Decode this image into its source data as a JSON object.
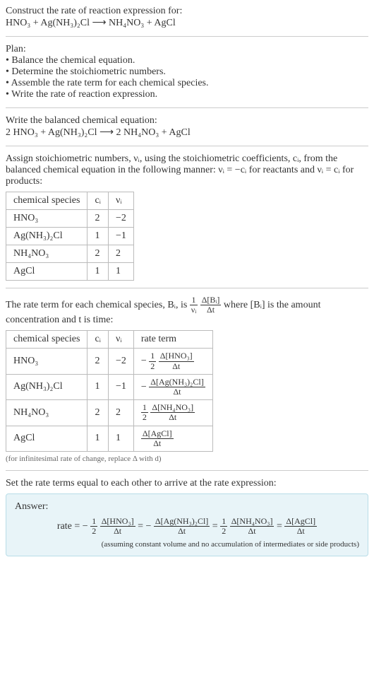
{
  "header": {
    "title": "Construct the rate of reaction expression for:",
    "equation": "HNO₃ + Ag(NH₃)₂Cl  ⟶  NH₄NO₃ + AgCl"
  },
  "plan": {
    "title": "Plan:",
    "items": [
      "• Balance the chemical equation.",
      "• Determine the stoichiometric numbers.",
      "• Assemble the rate term for each chemical species.",
      "• Write the rate of reaction expression."
    ]
  },
  "balanced": {
    "title": "Write the balanced chemical equation:",
    "equation": "2 HNO₃ + Ag(NH₃)₂Cl  ⟶  2 NH₄NO₃ + AgCl"
  },
  "stoich": {
    "intro": "Assign stoichiometric numbers, νᵢ, using the stoichiometric coefficients, cᵢ, from the balanced chemical equation in the following manner: νᵢ = −cᵢ for reactants and νᵢ = cᵢ for products:",
    "headers": [
      "chemical species",
      "cᵢ",
      "νᵢ"
    ],
    "rows": [
      {
        "species": "HNO₃",
        "c": "2",
        "v": "−2"
      },
      {
        "species": "Ag(NH₃)₂Cl",
        "c": "1",
        "v": "−1"
      },
      {
        "species": "NH₄NO₃",
        "c": "2",
        "v": "2"
      },
      {
        "species": "AgCl",
        "c": "1",
        "v": "1"
      }
    ]
  },
  "rateterm": {
    "intro_a": "The rate term for each chemical species, Bᵢ, is ",
    "intro_b": " where [Bᵢ] is the amount concentration and t is time:",
    "headers": [
      "chemical species",
      "cᵢ",
      "νᵢ",
      "rate term"
    ],
    "rows": [
      {
        "species": "HNO₃",
        "c": "2",
        "v": "−2",
        "sign": "−",
        "coef_num": "1",
        "coef_den": "2",
        "delta": "Δ[HNO₃]"
      },
      {
        "species": "Ag(NH₃)₂Cl",
        "c": "1",
        "v": "−1",
        "sign": "−",
        "coef_num": "",
        "coef_den": "",
        "delta": "Δ[Ag(NH₃)₂Cl]"
      },
      {
        "species": "NH₄NO₃",
        "c": "2",
        "v": "2",
        "sign": "",
        "coef_num": "1",
        "coef_den": "2",
        "delta": "Δ[NH₄NO₃]"
      },
      {
        "species": "AgCl",
        "c": "1",
        "v": "1",
        "sign": "",
        "coef_num": "",
        "coef_den": "",
        "delta": "Δ[AgCl]"
      }
    ],
    "note": "(for infinitesimal rate of change, replace Δ with d)"
  },
  "final": {
    "title": "Set the rate terms equal to each other to arrive at the rate expression:",
    "answer_label": "Answer:",
    "expr_prefix": "rate = ",
    "note": "(assuming constant volume and no accumulation of intermediates or side products)"
  },
  "symbols": {
    "dt": "Δt",
    "one_over_nu": {
      "num": "1",
      "den": "νᵢ"
    },
    "dBi": {
      "num": "Δ[Bᵢ]",
      "den": "Δt"
    }
  },
  "chart_data": {
    "type": "table",
    "title": "Stoichiometric numbers and rate terms",
    "species": [
      "HNO₃",
      "Ag(NH₃)₂Cl",
      "NH₄NO₃",
      "AgCl"
    ],
    "c_i": [
      2,
      1,
      2,
      1
    ],
    "nu_i": [
      -2,
      -1,
      2,
      1
    ],
    "rate_expression": "rate = -(1/2) Δ[HNO₃]/Δt = -Δ[Ag(NH₃)₂Cl]/Δt = (1/2) Δ[NH₄NO₃]/Δt = Δ[AgCl]/Δt"
  }
}
